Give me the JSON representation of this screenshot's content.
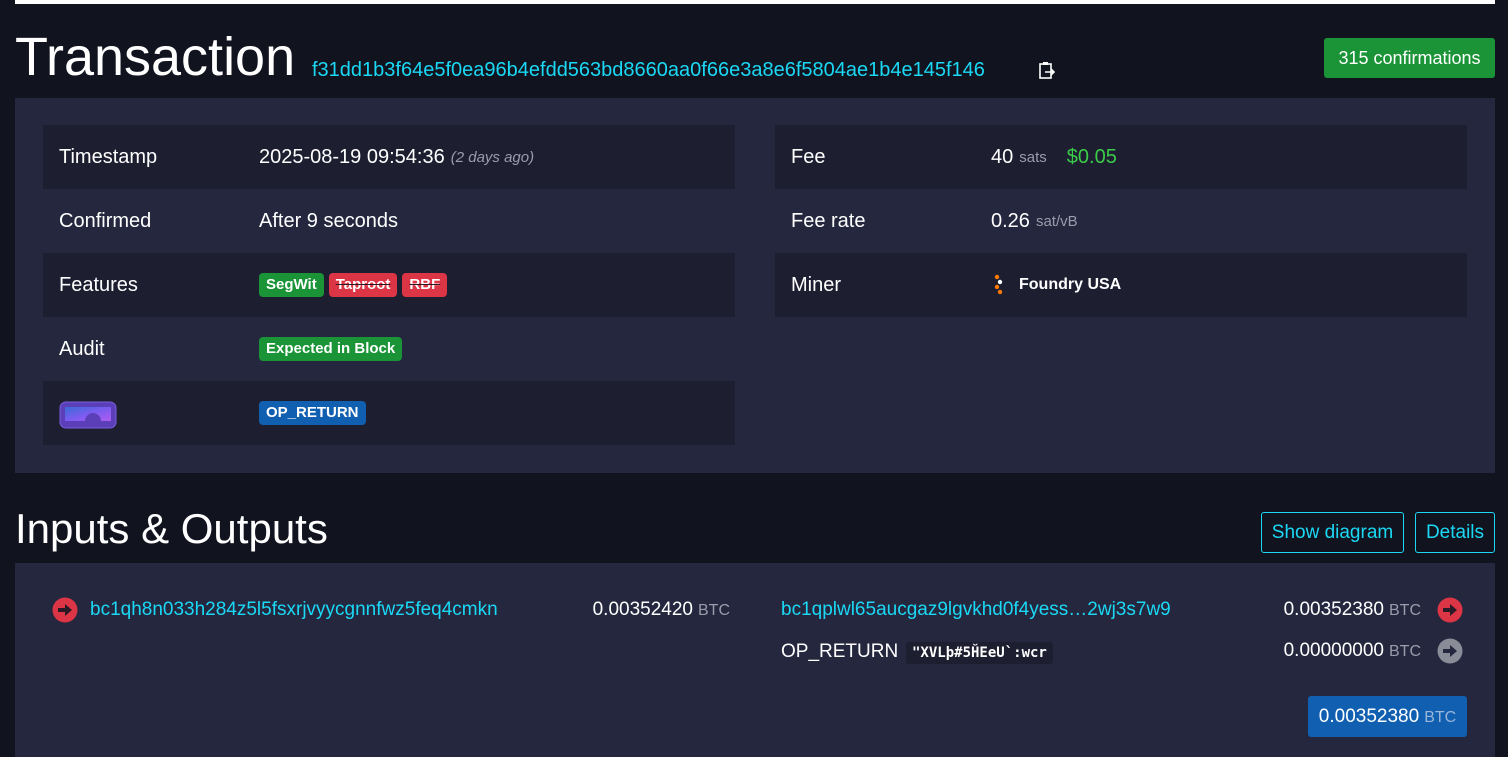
{
  "header": {
    "title": "Transaction",
    "txid": "f31dd1b3f64e5f0ea96b4efdd563bd8660aa0f66e3a8e6f5804ae1b4e145f146",
    "confirmations": "315 confirmations"
  },
  "details": {
    "timestamp_label": "Timestamp",
    "timestamp_value": "2025-08-19 09:54:36",
    "timestamp_ago": "(2 days ago)",
    "confirmed_label": "Confirmed",
    "confirmed_value": "After 9 seconds",
    "features_label": "Features",
    "features": [
      "SegWit",
      "Taproot",
      "RBF"
    ],
    "audit_label": "Audit",
    "audit_value": "Expected in Block",
    "accel_tag": "OP_RETURN",
    "fee_label": "Fee",
    "fee_value": "40",
    "fee_unit": "sats",
    "fee_fiat": "$0.05",
    "feerate_label": "Fee rate",
    "feerate_value": "0.26",
    "feerate_unit": "sat/vB",
    "miner_label": "Miner",
    "miner_value": "Foundry USA"
  },
  "io": {
    "title": "Inputs & Outputs",
    "show_diagram": "Show diagram",
    "details_button": "Details",
    "inputs": [
      {
        "address": "bc1qh8n033h284z5l5fsxrjvyycgnnfwz5feq4cmkn",
        "amount": "0.00352420",
        "unit": "BTC"
      }
    ],
    "outputs": [
      {
        "address": "bc1qplwl65aucgaz9lgvkhd0f4yess…2wj3s7w9",
        "amount": "0.00352380",
        "unit": "BTC"
      },
      {
        "label": "OP_RETURN",
        "data": "\"XVLþ#5ȞEeU`:wcr",
        "amount": "0.00000000",
        "unit": "BTC"
      }
    ],
    "total": "0.00352380",
    "total_unit": "BTC"
  },
  "colors": {
    "background": "#11131f",
    "panel": "#24273e",
    "accent_link": "#1bd8f4",
    "success": "#1a9436",
    "danger": "#dc3545",
    "primary": "#105fb0"
  },
  "icons": [
    "copy-icon",
    "arrow-right-red-icon",
    "arrow-right-grey-icon",
    "foundry-logo-icon",
    "accelerator-icon"
  ]
}
